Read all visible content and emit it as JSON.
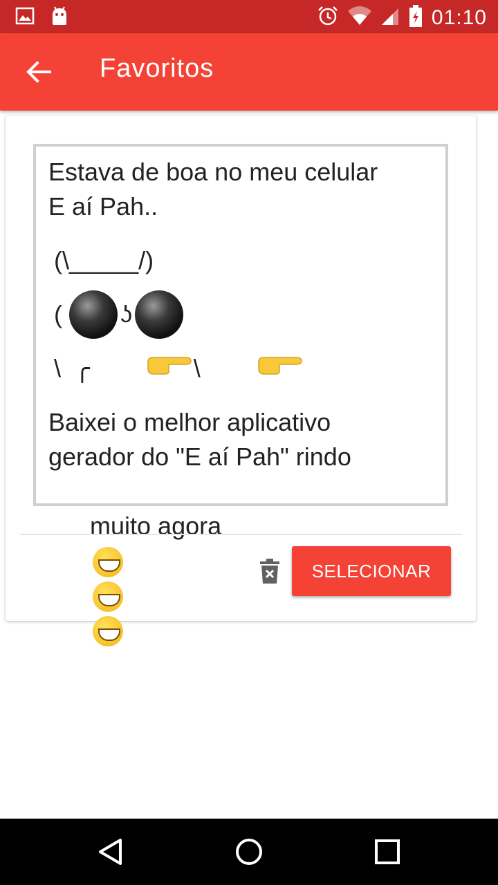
{
  "status_bar": {
    "time": "01:10",
    "icons": [
      "image-icon",
      "android-icon",
      "alarm-icon",
      "wifi-icon",
      "signal-icon",
      "battery-icon"
    ]
  },
  "app_bar": {
    "title": "Favoritos",
    "back_icon": "arrow-back-icon"
  },
  "card": {
    "message": {
      "line1": "Estava de boa no meu celular",
      "line2": "E aí Pah..",
      "art1": "(\\_____/)",
      "art2_prefix": "( ",
      "art2_mid": "ʖ",
      "art3_prefix": "\\  ╭",
      "art3_mid": "\\",
      "line3": "Baixei o melhor aplicativo",
      "line4": "gerador do \"E aí Pah\" rindo",
      "line5": "muito agora"
    },
    "delete_icon": "delete-forever-icon",
    "select_label": "SELECIONAR"
  },
  "nav_bar": {
    "back_icon": "nav-back-icon",
    "home_icon": "nav-home-icon",
    "recents_icon": "nav-recents-icon"
  },
  "colors": {
    "status_bar": "#c62828",
    "app_bar": "#f44336",
    "button": "#f44336"
  }
}
